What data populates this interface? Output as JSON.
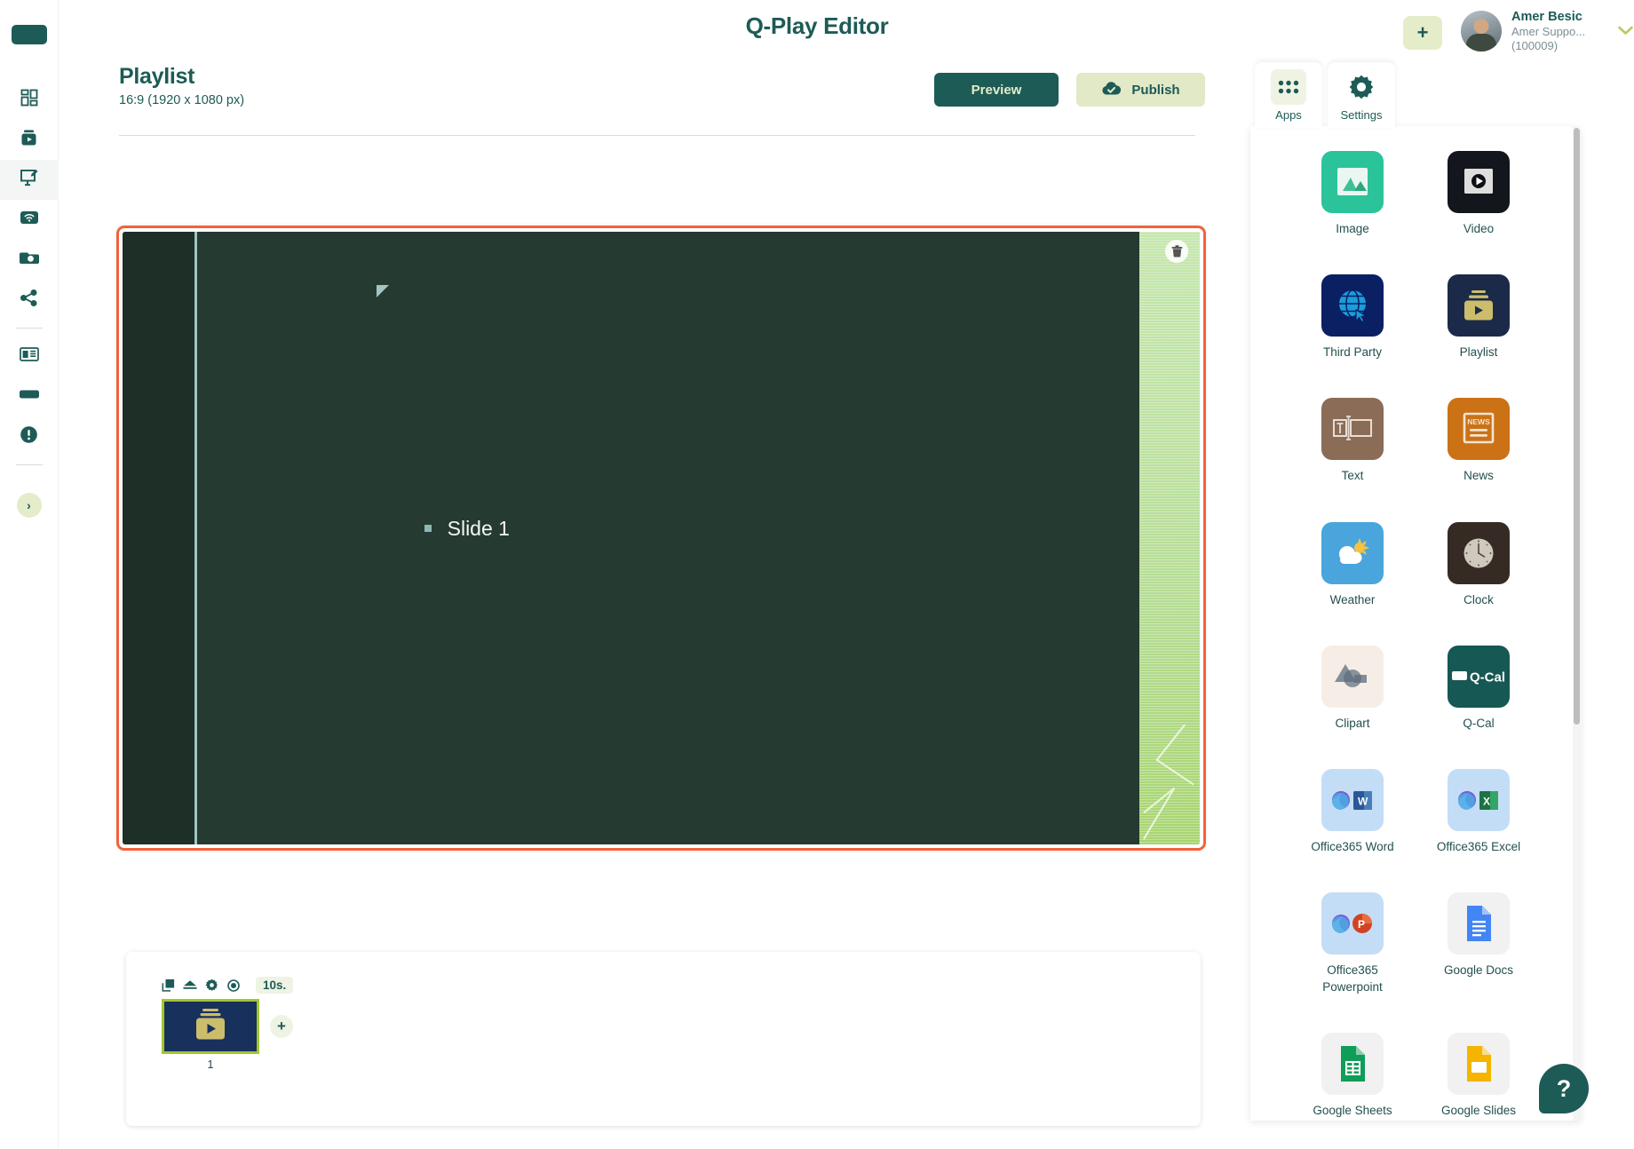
{
  "app": {
    "title": "Q-Play Editor"
  },
  "user": {
    "name": "Amer Besic",
    "subtitle": "Amer Suppo...(100009)",
    "add_label": "+",
    "caret": "chevron-down"
  },
  "page": {
    "title": "Playlist",
    "subtitle": "16:9 (1920 x 1080 px)"
  },
  "toolbar": {
    "preview_label": "Preview",
    "publish_label": "Publish"
  },
  "sidebar": {
    "items": [
      {
        "name": "dashboard",
        "icon": "dashboard-icon"
      },
      {
        "name": "media",
        "icon": "media-box-icon"
      },
      {
        "name": "editor",
        "icon": "editor-screen-icon",
        "active": true
      },
      {
        "name": "broadcast",
        "icon": "wifi-screen-icon"
      },
      {
        "name": "player",
        "icon": "player-card-icon"
      },
      {
        "name": "share",
        "icon": "share-icon"
      },
      {
        "name": "news",
        "icon": "news-card-icon"
      },
      {
        "name": "display",
        "icon": "display-bar-icon"
      },
      {
        "name": "alerts",
        "icon": "alert-circle-icon"
      }
    ],
    "expand_label": "›"
  },
  "canvas": {
    "slide_label": "Slide 1",
    "delete_tooltip": "trash-icon",
    "bg_color": "#253a30",
    "left_band_color": "#1e2f27",
    "divider_color": "#9fc6c0",
    "accent_border": "#f4613a",
    "right_gradient_from": "#c5e6ae",
    "right_gradient_to": "#a8d570"
  },
  "timeline": {
    "duration": "10s.",
    "slide_number": "1",
    "add_label": "+",
    "tools": [
      {
        "name": "duplicate",
        "icon": "duplicate-icon"
      },
      {
        "name": "transition",
        "icon": "transition-icon"
      },
      {
        "name": "settings",
        "icon": "gear-icon"
      },
      {
        "name": "preview",
        "icon": "eye-icon"
      }
    ],
    "thumb_bg": "#18305c",
    "thumb_border": "#a4c62b"
  },
  "right_panel": {
    "tabs": [
      {
        "label": "Apps",
        "icon": "grid-dots-icon",
        "active": true
      },
      {
        "label": "Settings",
        "icon": "gear-icon",
        "active": false
      }
    ],
    "apps": [
      {
        "label": "Image",
        "icon": "image-icon",
        "bg": "#2bc49a"
      },
      {
        "label": "Video",
        "icon": "video-icon",
        "bg": "#13161c"
      },
      {
        "label": "Third Party",
        "icon": "globe-icon",
        "bg": "#0b1f63"
      },
      {
        "label": "Playlist",
        "icon": "playlist-icon",
        "bg": "#1c2a4a"
      },
      {
        "label": "Text",
        "icon": "text-icon",
        "bg": "#8b6c57"
      },
      {
        "label": "News",
        "icon": "news-icon",
        "bg": "#cb7216"
      },
      {
        "label": "Weather",
        "icon": "weather-icon",
        "bg": "#4aa5dd"
      },
      {
        "label": "Clock",
        "icon": "clock-icon",
        "bg": "#362b24"
      },
      {
        "label": "Clipart",
        "icon": "clipart-icon",
        "bg": "#f6eee6"
      },
      {
        "label": "Q-Cal",
        "icon": "qcal-icon",
        "bg": "#165853"
      },
      {
        "label": "Office365 Word",
        "icon": "word-icon",
        "bg": "#c3ddf7"
      },
      {
        "label": "Office365 Excel",
        "icon": "excel-icon",
        "bg": "#c3ddf7"
      },
      {
        "label": "Office365 Powerpoint",
        "icon": "powerpoint-icon",
        "bg": "#c3ddf7"
      },
      {
        "label": "Google Docs",
        "icon": "gdocs-icon",
        "bg": "#f1f1f1"
      },
      {
        "label": "Google Sheets",
        "icon": "gsheets-icon",
        "bg": "#f1f1f1"
      },
      {
        "label": "Google Slides",
        "icon": "gslides-icon",
        "bg": "#f1f1f1"
      }
    ]
  },
  "help": {
    "label": "?"
  },
  "theme": {
    "brand": "#1d5b56",
    "accent_light": "#e4ecc9",
    "highlight": "#f4613a"
  }
}
